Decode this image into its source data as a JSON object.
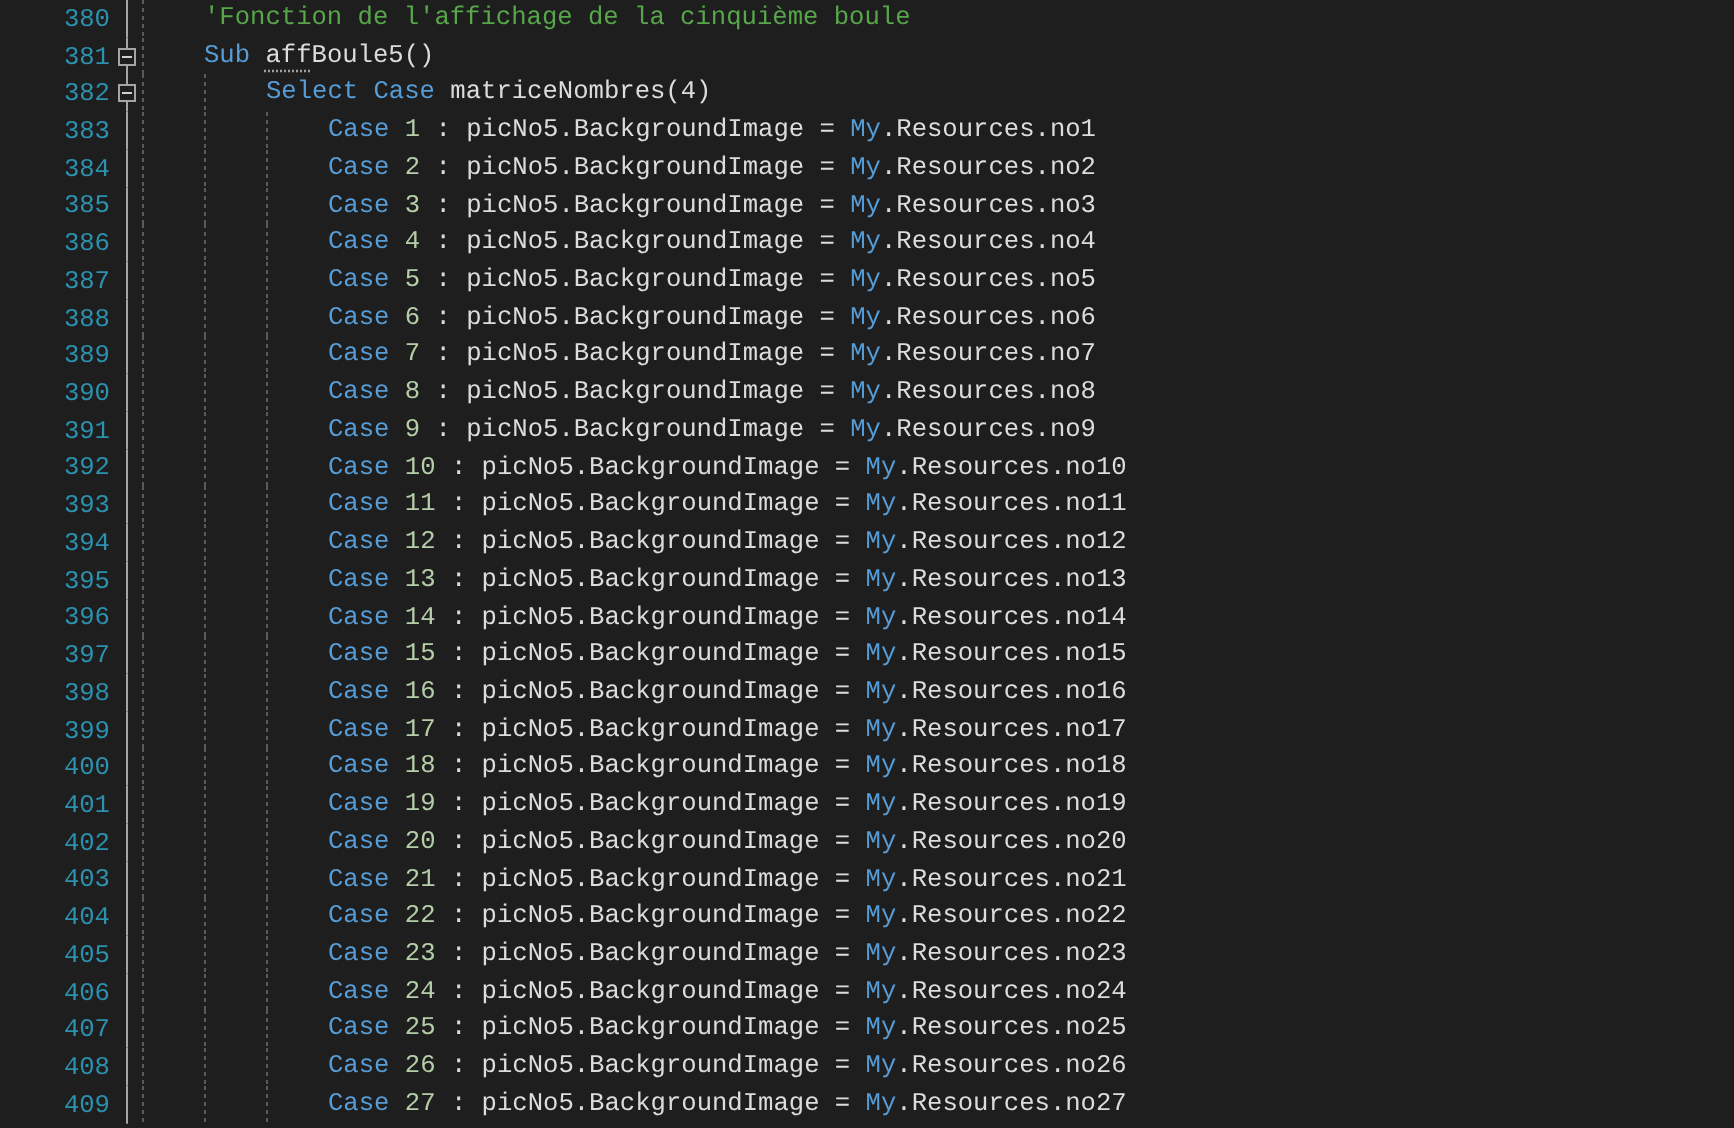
{
  "editor": {
    "lines": [
      {
        "number": "380",
        "tokens": [
          {
            "kind": "comment",
            "text": "'Fonction de l'affichage de la cinquième boule"
          }
        ]
      },
      {
        "number": "381",
        "tokens": [
          {
            "kind": "keyword",
            "text": "Sub "
          },
          {
            "kind": "plain",
            "text": "aff",
            "suggestion": true
          },
          {
            "kind": "plain",
            "text": "Boule5()"
          }
        ],
        "expanded": true,
        "children": [
          {
            "number": "382",
            "tokens": [
              {
                "kind": "keyword",
                "text": "Select Case"
              },
              {
                "kind": "plain",
                "text": " matriceNombres(4)"
              }
            ],
            "expanded": true,
            "children": [
              {
                "number": "383",
                "tokens": [
                  {
                    "kind": "keyword",
                    "text": "Case"
                  },
                  {
                    "kind": "number",
                    "text": " 1"
                  },
                  {
                    "kind": "plain",
                    "text": " : picNo5.BackgroundImage = "
                  },
                  {
                    "kind": "keyword",
                    "text": "My"
                  },
                  {
                    "kind": "plain",
                    "text": ".Resources.no1"
                  }
                ]
              },
              {
                "number": "384",
                "tokens": [
                  {
                    "kind": "keyword",
                    "text": "Case"
                  },
                  {
                    "kind": "number",
                    "text": " 2"
                  },
                  {
                    "kind": "plain",
                    "text": " : picNo5.BackgroundImage = "
                  },
                  {
                    "kind": "keyword",
                    "text": "My"
                  },
                  {
                    "kind": "plain",
                    "text": ".Resources.no2"
                  }
                ]
              },
              {
                "number": "385",
                "tokens": [
                  {
                    "kind": "keyword",
                    "text": "Case"
                  },
                  {
                    "kind": "number",
                    "text": " 3"
                  },
                  {
                    "kind": "plain",
                    "text": " : picNo5.BackgroundImage = "
                  },
                  {
                    "kind": "keyword",
                    "text": "My"
                  },
                  {
                    "kind": "plain",
                    "text": ".Resources.no3"
                  }
                ]
              },
              {
                "number": "386",
                "tokens": [
                  {
                    "kind": "keyword",
                    "text": "Case"
                  },
                  {
                    "kind": "number",
                    "text": " 4"
                  },
                  {
                    "kind": "plain",
                    "text": " : picNo5.BackgroundImage = "
                  },
                  {
                    "kind": "keyword",
                    "text": "My"
                  },
                  {
                    "kind": "plain",
                    "text": ".Resources.no4"
                  }
                ]
              },
              {
                "number": "387",
                "tokens": [
                  {
                    "kind": "keyword",
                    "text": "Case"
                  },
                  {
                    "kind": "number",
                    "text": " 5"
                  },
                  {
                    "kind": "plain",
                    "text": " : picNo5.BackgroundImage = "
                  },
                  {
                    "kind": "keyword",
                    "text": "My"
                  },
                  {
                    "kind": "plain",
                    "text": ".Resources.no5"
                  }
                ]
              },
              {
                "number": "388",
                "tokens": [
                  {
                    "kind": "keyword",
                    "text": "Case"
                  },
                  {
                    "kind": "number",
                    "text": " 6"
                  },
                  {
                    "kind": "plain",
                    "text": " : picNo5.BackgroundImage = "
                  },
                  {
                    "kind": "keyword",
                    "text": "My"
                  },
                  {
                    "kind": "plain",
                    "text": ".Resources.no6"
                  }
                ]
              },
              {
                "number": "389",
                "tokens": [
                  {
                    "kind": "keyword",
                    "text": "Case"
                  },
                  {
                    "kind": "number",
                    "text": " 7"
                  },
                  {
                    "kind": "plain",
                    "text": " : picNo5.BackgroundImage = "
                  },
                  {
                    "kind": "keyword",
                    "text": "My"
                  },
                  {
                    "kind": "plain",
                    "text": ".Resources.no7"
                  }
                ]
              },
              {
                "number": "390",
                "tokens": [
                  {
                    "kind": "keyword",
                    "text": "Case"
                  },
                  {
                    "kind": "number",
                    "text": " 8"
                  },
                  {
                    "kind": "plain",
                    "text": " : picNo5.BackgroundImage = "
                  },
                  {
                    "kind": "keyword",
                    "text": "My"
                  },
                  {
                    "kind": "plain",
                    "text": ".Resources.no8"
                  }
                ]
              },
              {
                "number": "391",
                "tokens": [
                  {
                    "kind": "keyword",
                    "text": "Case"
                  },
                  {
                    "kind": "number",
                    "text": " 9"
                  },
                  {
                    "kind": "plain",
                    "text": " : picNo5.BackgroundImage = "
                  },
                  {
                    "kind": "keyword",
                    "text": "My"
                  },
                  {
                    "kind": "plain",
                    "text": ".Resources.no9"
                  }
                ]
              },
              {
                "number": "392",
                "tokens": [
                  {
                    "kind": "keyword",
                    "text": "Case"
                  },
                  {
                    "kind": "number",
                    "text": " 10"
                  },
                  {
                    "kind": "plain",
                    "text": " : picNo5.BackgroundImage = "
                  },
                  {
                    "kind": "keyword",
                    "text": "My"
                  },
                  {
                    "kind": "plain",
                    "text": ".Resources.no10"
                  }
                ]
              },
              {
                "number": "393",
                "tokens": [
                  {
                    "kind": "keyword",
                    "text": "Case"
                  },
                  {
                    "kind": "number",
                    "text": " 11"
                  },
                  {
                    "kind": "plain",
                    "text": " : picNo5.BackgroundImage = "
                  },
                  {
                    "kind": "keyword",
                    "text": "My"
                  },
                  {
                    "kind": "plain",
                    "text": ".Resources.no11"
                  }
                ]
              },
              {
                "number": "394",
                "tokens": [
                  {
                    "kind": "keyword",
                    "text": "Case"
                  },
                  {
                    "kind": "number",
                    "text": " 12"
                  },
                  {
                    "kind": "plain",
                    "text": " : picNo5.BackgroundImage = "
                  },
                  {
                    "kind": "keyword",
                    "text": "My"
                  },
                  {
                    "kind": "plain",
                    "text": ".Resources.no12"
                  }
                ]
              },
              {
                "number": "395",
                "tokens": [
                  {
                    "kind": "keyword",
                    "text": "Case"
                  },
                  {
                    "kind": "number",
                    "text": " 13"
                  },
                  {
                    "kind": "plain",
                    "text": " : picNo5.BackgroundImage = "
                  },
                  {
                    "kind": "keyword",
                    "text": "My"
                  },
                  {
                    "kind": "plain",
                    "text": ".Resources.no13"
                  }
                ]
              },
              {
                "number": "396",
                "tokens": [
                  {
                    "kind": "keyword",
                    "text": "Case"
                  },
                  {
                    "kind": "number",
                    "text": " 14"
                  },
                  {
                    "kind": "plain",
                    "text": " : picNo5.BackgroundImage = "
                  },
                  {
                    "kind": "keyword",
                    "text": "My"
                  },
                  {
                    "kind": "plain",
                    "text": ".Resources.no14"
                  }
                ]
              },
              {
                "number": "397",
                "tokens": [
                  {
                    "kind": "keyword",
                    "text": "Case"
                  },
                  {
                    "kind": "number",
                    "text": " 15"
                  },
                  {
                    "kind": "plain",
                    "text": " : picNo5.BackgroundImage = "
                  },
                  {
                    "kind": "keyword",
                    "text": "My"
                  },
                  {
                    "kind": "plain",
                    "text": ".Resources.no15"
                  }
                ]
              },
              {
                "number": "398",
                "tokens": [
                  {
                    "kind": "keyword",
                    "text": "Case"
                  },
                  {
                    "kind": "number",
                    "text": " 16"
                  },
                  {
                    "kind": "plain",
                    "text": " : picNo5.BackgroundImage = "
                  },
                  {
                    "kind": "keyword",
                    "text": "My"
                  },
                  {
                    "kind": "plain",
                    "text": ".Resources.no16"
                  }
                ]
              },
              {
                "number": "399",
                "tokens": [
                  {
                    "kind": "keyword",
                    "text": "Case"
                  },
                  {
                    "kind": "number",
                    "text": " 17"
                  },
                  {
                    "kind": "plain",
                    "text": " : picNo5.BackgroundImage = "
                  },
                  {
                    "kind": "keyword",
                    "text": "My"
                  },
                  {
                    "kind": "plain",
                    "text": ".Resources.no17"
                  }
                ]
              },
              {
                "number": "400",
                "tokens": [
                  {
                    "kind": "keyword",
                    "text": "Case"
                  },
                  {
                    "kind": "number",
                    "text": " 18"
                  },
                  {
                    "kind": "plain",
                    "text": " : picNo5.BackgroundImage = "
                  },
                  {
                    "kind": "keyword",
                    "text": "My"
                  },
                  {
                    "kind": "plain",
                    "text": ".Resources.no18"
                  }
                ]
              },
              {
                "number": "401",
                "tokens": [
                  {
                    "kind": "keyword",
                    "text": "Case"
                  },
                  {
                    "kind": "number",
                    "text": " 19"
                  },
                  {
                    "kind": "plain",
                    "text": " : picNo5.BackgroundImage = "
                  },
                  {
                    "kind": "keyword",
                    "text": "My"
                  },
                  {
                    "kind": "plain",
                    "text": ".Resources.no19"
                  }
                ]
              },
              {
                "number": "402",
                "tokens": [
                  {
                    "kind": "keyword",
                    "text": "Case"
                  },
                  {
                    "kind": "number",
                    "text": " 20"
                  },
                  {
                    "kind": "plain",
                    "text": " : picNo5.BackgroundImage = "
                  },
                  {
                    "kind": "keyword",
                    "text": "My"
                  },
                  {
                    "kind": "plain",
                    "text": ".Resources.no20"
                  }
                ]
              },
              {
                "number": "403",
                "tokens": [
                  {
                    "kind": "keyword",
                    "text": "Case"
                  },
                  {
                    "kind": "number",
                    "text": " 21"
                  },
                  {
                    "kind": "plain",
                    "text": " : picNo5.BackgroundImage = "
                  },
                  {
                    "kind": "keyword",
                    "text": "My"
                  },
                  {
                    "kind": "plain",
                    "text": ".Resources.no21"
                  }
                ]
              },
              {
                "number": "404",
                "tokens": [
                  {
                    "kind": "keyword",
                    "text": "Case"
                  },
                  {
                    "kind": "number",
                    "text": " 22"
                  },
                  {
                    "kind": "plain",
                    "text": " : picNo5.BackgroundImage = "
                  },
                  {
                    "kind": "keyword",
                    "text": "My"
                  },
                  {
                    "kind": "plain",
                    "text": ".Resources.no22"
                  }
                ]
              },
              {
                "number": "405",
                "tokens": [
                  {
                    "kind": "keyword",
                    "text": "Case"
                  },
                  {
                    "kind": "number",
                    "text": " 23"
                  },
                  {
                    "kind": "plain",
                    "text": " : picNo5.BackgroundImage = "
                  },
                  {
                    "kind": "keyword",
                    "text": "My"
                  },
                  {
                    "kind": "plain",
                    "text": ".Resources.no23"
                  }
                ]
              },
              {
                "number": "406",
                "tokens": [
                  {
                    "kind": "keyword",
                    "text": "Case"
                  },
                  {
                    "kind": "number",
                    "text": " 24"
                  },
                  {
                    "kind": "plain",
                    "text": " : picNo5.BackgroundImage = "
                  },
                  {
                    "kind": "keyword",
                    "text": "My"
                  },
                  {
                    "kind": "plain",
                    "text": ".Resources.no24"
                  }
                ]
              },
              {
                "number": "407",
                "tokens": [
                  {
                    "kind": "keyword",
                    "text": "Case"
                  },
                  {
                    "kind": "number",
                    "text": " 25"
                  },
                  {
                    "kind": "plain",
                    "text": " : picNo5.BackgroundImage = "
                  },
                  {
                    "kind": "keyword",
                    "text": "My"
                  },
                  {
                    "kind": "plain",
                    "text": ".Resources.no25"
                  }
                ]
              },
              {
                "number": "408",
                "tokens": [
                  {
                    "kind": "keyword",
                    "text": "Case"
                  },
                  {
                    "kind": "number",
                    "text": " 26"
                  },
                  {
                    "kind": "plain",
                    "text": " : picNo5.BackgroundImage = "
                  },
                  {
                    "kind": "keyword",
                    "text": "My"
                  },
                  {
                    "kind": "plain",
                    "text": ".Resources.no26"
                  }
                ]
              },
              {
                "number": "409",
                "tokens": [
                  {
                    "kind": "keyword",
                    "text": "Case"
                  },
                  {
                    "kind": "number",
                    "text": " 27"
                  },
                  {
                    "kind": "plain",
                    "text": " : picNo5.BackgroundImage = "
                  },
                  {
                    "kind": "keyword",
                    "text": "My"
                  },
                  {
                    "kind": "plain",
                    "text": ".Resources.no27"
                  }
                ]
              }
            ]
          }
        ]
      }
    ]
  }
}
